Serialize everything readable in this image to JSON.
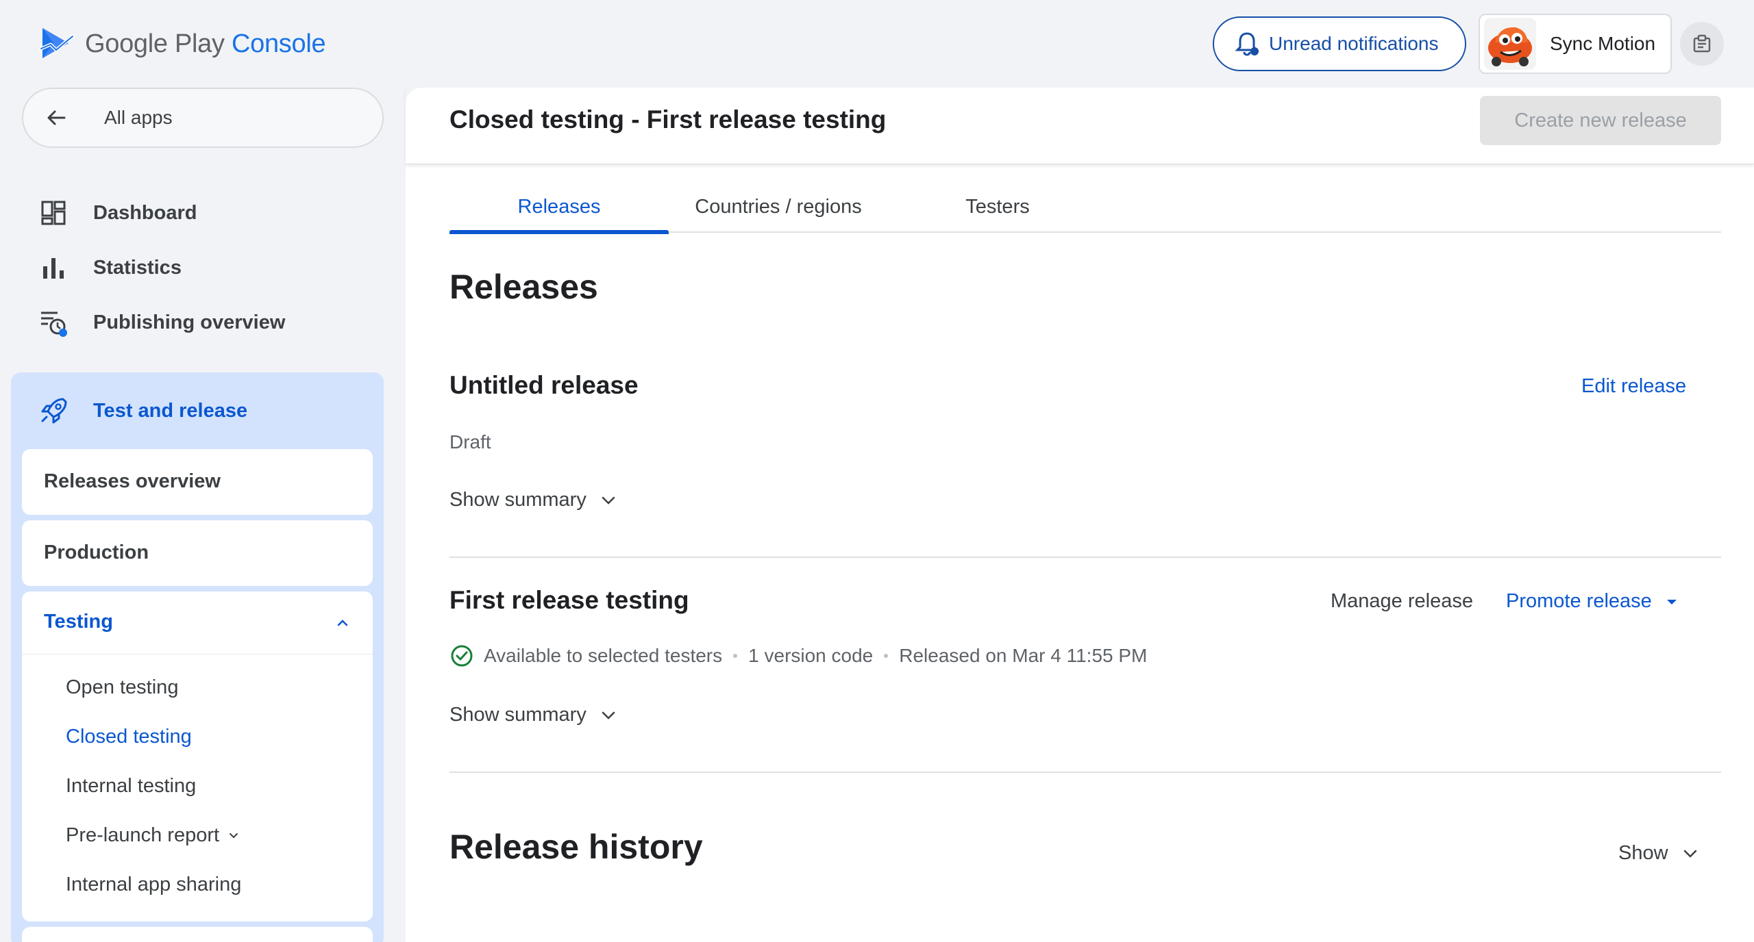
{
  "brand": {
    "google_play": "Google Play",
    "console": "Console"
  },
  "topbar": {
    "notifications_label": "Unread notifications",
    "account_name": "Sync Motion"
  },
  "sidebar": {
    "all_apps": "All apps",
    "items": [
      {
        "label": "Dashboard",
        "icon": "dashboard-icon"
      },
      {
        "label": "Statistics",
        "icon": "statistics-icon"
      },
      {
        "label": "Publishing overview",
        "icon": "publishing-overview-icon"
      }
    ],
    "section": {
      "label": "Test and release",
      "icon": "rocket-icon",
      "releases_overview": "Releases overview",
      "production": "Production",
      "testing": {
        "label": "Testing",
        "items": [
          {
            "label": "Open testing"
          },
          {
            "label": "Closed testing"
          },
          {
            "label": "Internal testing"
          },
          {
            "label": "Pre-launch report"
          },
          {
            "label": "Internal app sharing"
          }
        ]
      }
    }
  },
  "header": {
    "title": "Closed testing - First release testing",
    "create_button": "Create new release"
  },
  "tabs": [
    {
      "label": "Releases"
    },
    {
      "label": "Countries / regions"
    },
    {
      "label": "Testers"
    }
  ],
  "content": {
    "releases_heading": "Releases",
    "untitled": {
      "title": "Untitled release",
      "edit": "Edit release",
      "status": "Draft",
      "show_summary": "Show summary"
    },
    "first_release": {
      "title": "First release testing",
      "manage": "Manage release",
      "promote": "Promote release",
      "status": "Available to selected testers",
      "version_codes": "1 version code",
      "released_on": "Released on Mar 4 11:55 PM",
      "show_summary": "Show summary"
    },
    "history": {
      "heading": "Release history",
      "show": "Show"
    }
  },
  "colors": {
    "accent": "#0b57d0",
    "sidebar_section_bg": "#d3e3fd",
    "page_bg": "#f1f3f6",
    "success": "#188038"
  }
}
